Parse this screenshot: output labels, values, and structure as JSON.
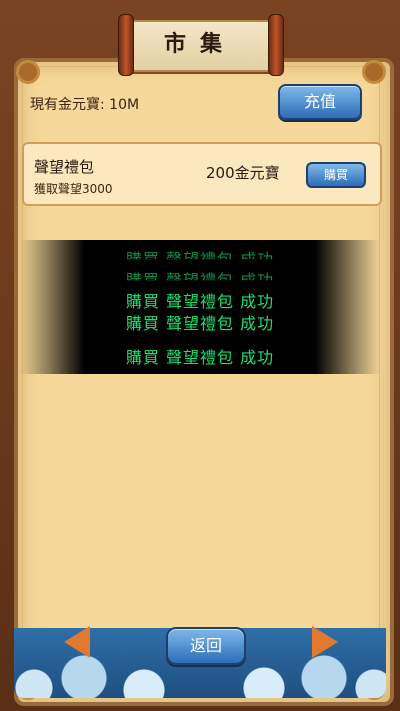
{
  "header": {
    "title": "市集"
  },
  "wallet": {
    "label": "現有金元寶: 10M",
    "topup_label": "充值"
  },
  "item": {
    "name": "聲望禮包",
    "description": "獲取聲望3000",
    "price": "200金元寶",
    "buy_label": "購買"
  },
  "toast": {
    "lines": [
      "購買 聲望禮包 成功",
      "購買 聲望禮包 成功",
      "購買 聲望禮包 成功",
      "購買 聲望禮包 成功",
      "購買 聲望禮包 成功"
    ]
  },
  "footer": {
    "back_label": "返回"
  },
  "icons": {
    "prev": "prev-arrow-icon",
    "next": "next-arrow-icon"
  },
  "colors": {
    "toast_text": "#19e070",
    "button_blue": "#2d6db8",
    "arrow_orange": "#e17a2f"
  }
}
